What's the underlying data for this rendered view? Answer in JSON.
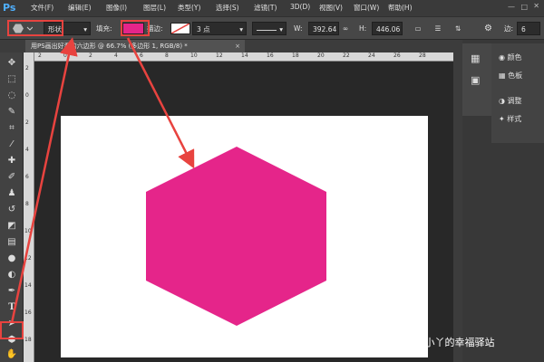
{
  "app": {
    "logo": "Ps"
  },
  "menu": [
    "文件(F)",
    "编辑(E)",
    "图像(I)",
    "图层(L)",
    "类型(Y)",
    "选择(S)",
    "滤镜(T)",
    "3D(D)",
    "视图(V)",
    "窗口(W)",
    "帮助(H)"
  ],
  "options": {
    "mode": "形状",
    "fill_label": "填充:",
    "fill_color": "#e5258a",
    "stroke_label": "描边:",
    "stroke_width": "3 点",
    "w_label": "W:",
    "w_value": "392.64",
    "h_label": "H:",
    "h_value": "446.06",
    "sides_label": "边:",
    "sides_value": "6"
  },
  "document": {
    "tab_title": "用PS画出好看的六边形 @ 66.7% (多边形 1, RGB/8) *",
    "close": "×",
    "ruler_top": [
      "2",
      "0",
      "2",
      "4",
      "6",
      "8",
      "10",
      "12",
      "14",
      "16",
      "18",
      "20",
      "22",
      "24",
      "26",
      "28"
    ],
    "ruler_left": [
      "2",
      "0",
      "2",
      "4",
      "6",
      "8",
      "10",
      "12",
      "14",
      "16",
      "18"
    ]
  },
  "canvas": {
    "background": "#ffffff"
  },
  "shape": {
    "type": "hexagon",
    "fill": "#e5258a"
  },
  "annotation": {
    "color": "#e8433f"
  },
  "panels": [
    {
      "icon": "color-swatch-icon",
      "label": "颜色"
    },
    {
      "icon": "swatches-grid-icon",
      "label": "色板"
    },
    {
      "icon": "adjustments-icon",
      "label": "调整"
    },
    {
      "icon": "styles-icon",
      "label": "样式"
    }
  ],
  "watermark": "头条 @小丫的幸福驿站"
}
